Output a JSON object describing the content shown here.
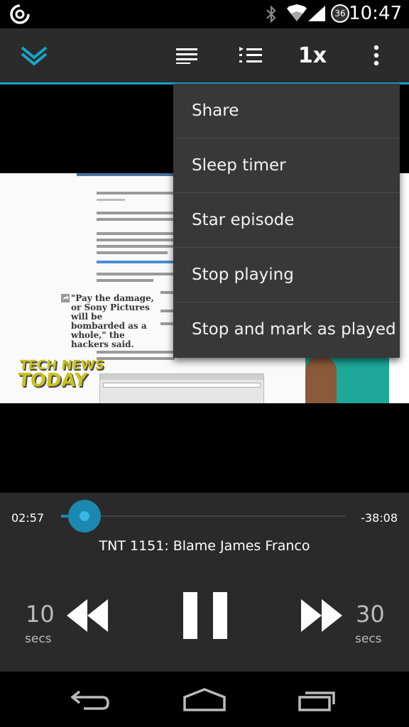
{
  "status_bar": {
    "time": "10:47",
    "battery_level": "36"
  },
  "toolbar": {
    "speed_label": "1x"
  },
  "menu": {
    "items": [
      {
        "label": "Share"
      },
      {
        "label": "Sleep timer"
      },
      {
        "label": "Star episode"
      },
      {
        "label": "Stop playing"
      },
      {
        "label": "Stop and mark as played"
      }
    ]
  },
  "video": {
    "quote": "\"Pay the damage, or Sony Pictures will be bombarded as a whole,\" the hackers said.",
    "logo_line1": "TECH NEWS",
    "logo_line2": "TODAY"
  },
  "player": {
    "elapsed": "02:57",
    "remaining": "-38:08",
    "progress": 0.072,
    "episode_title": "TNT 1151: Blame James Franco",
    "skip_back_value": "10",
    "skip_back_unit": "secs",
    "skip_fwd_value": "30",
    "skip_fwd_unit": "secs"
  },
  "colors": {
    "accent": "#1ba3c8",
    "menu_bg": "#383838",
    "player_bg": "#2a2a2a"
  }
}
